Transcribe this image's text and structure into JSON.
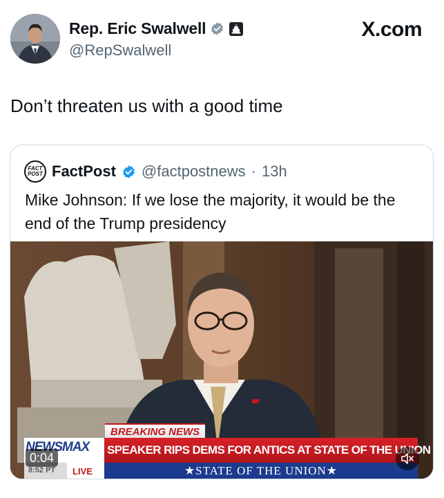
{
  "author": {
    "display_name": "Rep. Eric Swalwell",
    "handle": "@RepSwalwell",
    "verified_icon": "verified-badge-icon",
    "affiliation_icon": "government-capitol-icon"
  },
  "site_label": "X.com",
  "tweet": {
    "text": "Don’t threaten us with a good time"
  },
  "quoted_tweet": {
    "avatar_text_line1": "FACT",
    "avatar_text_line2": "POST",
    "display_name": "FactPost",
    "handle": "@factpostnews",
    "separator": "·",
    "age": "13h",
    "text": "Mike Johnson: If we lose the majority, it would be the end of the Trump presidency",
    "media": {
      "timestamp": "0:04",
      "breaking_label": "BREAKING NEWS",
      "network": "NEWSMAX",
      "headline": "SPEAKER RIPS DEMS FOR ANTICS AT STATE OF THE UNION",
      "subheadline": "★STATE OF THE UNION★",
      "clock": "8:52 PT",
      "live_label": "LIVE",
      "mute_icon": "speaker-muted-icon"
    }
  },
  "colors": {
    "text_primary": "#0f1419",
    "text_secondary": "#536471",
    "verified_blue": "#1d9bf0",
    "newsmax_red": "#c4161c",
    "newsmax_blue": "#1c3b8f"
  }
}
